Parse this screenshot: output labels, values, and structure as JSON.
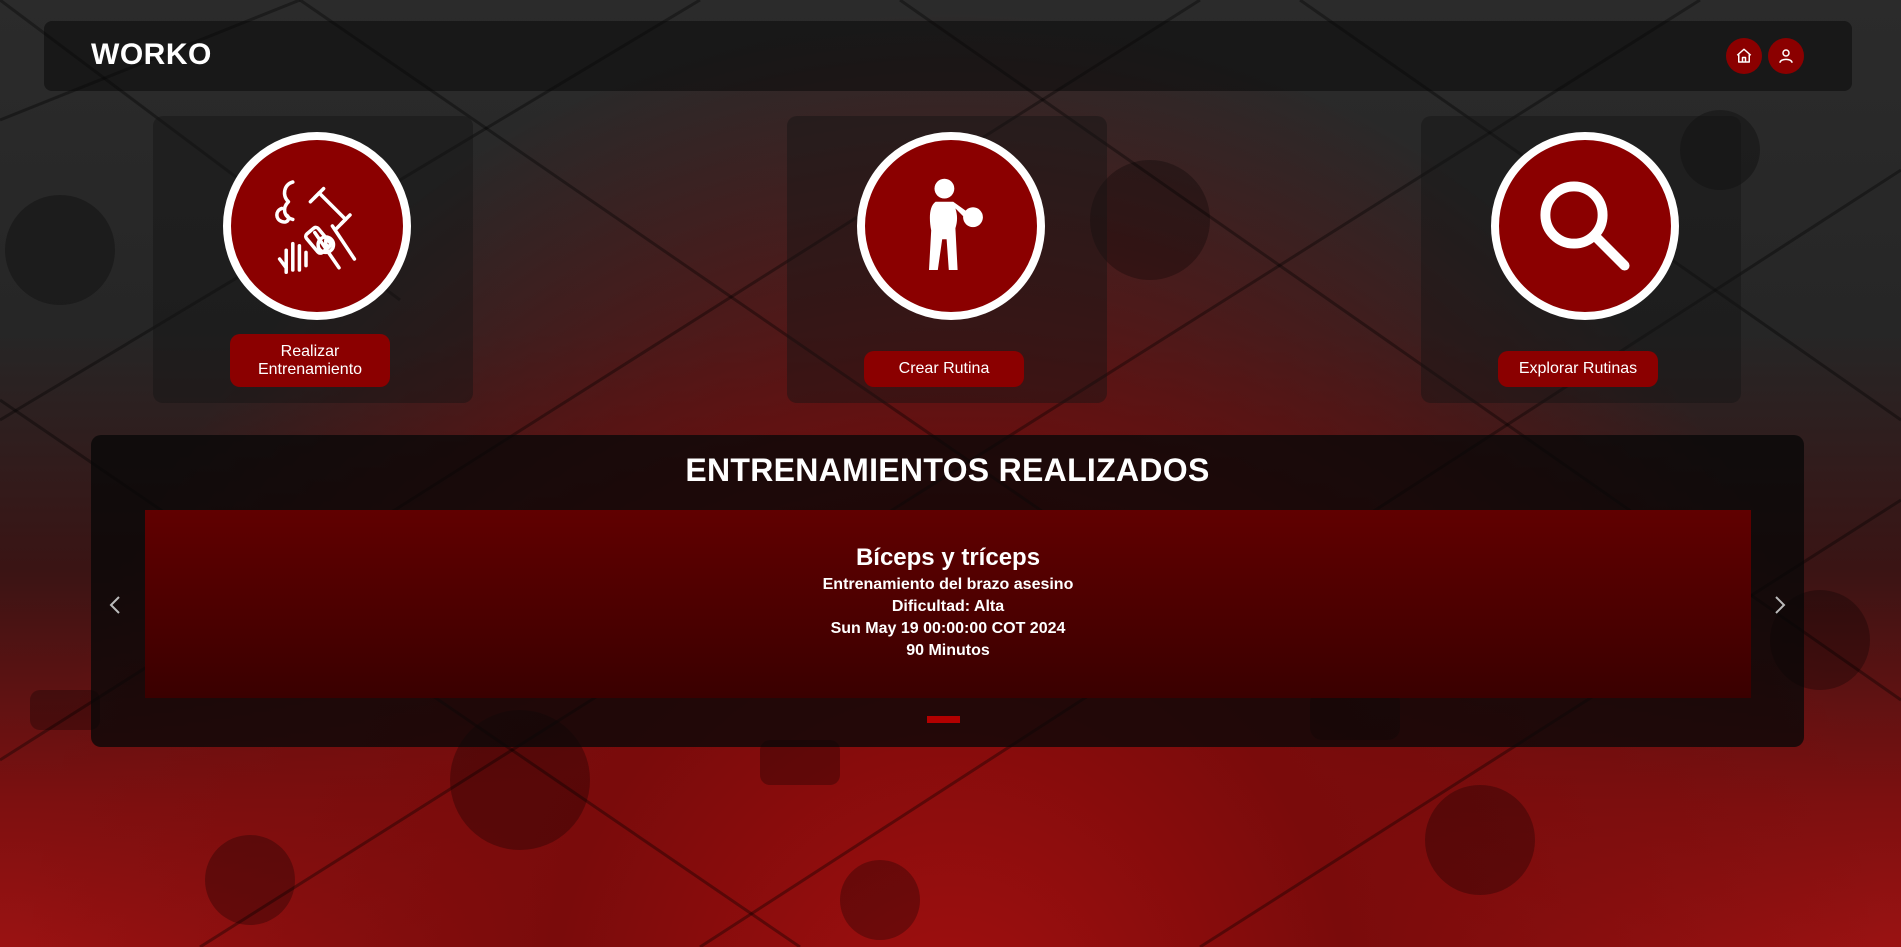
{
  "app": {
    "brand": "WORKO",
    "accent_color": "#8b0000"
  },
  "navbar": {
    "home_icon": "home-icon",
    "profile_icon": "user-icon"
  },
  "actions": [
    {
      "label": "Realizar Entrenamiento",
      "icon": "workout-equipment-icon"
    },
    {
      "label": "Crear Rutina",
      "icon": "person-ball-icon"
    },
    {
      "label": "Explorar Rutinas",
      "icon": "search-icon"
    }
  ],
  "history": {
    "title": "ENTRENAMIENTOS REALIZADOS",
    "slides": [
      {
        "name": "Bíceps y tríceps",
        "description": "Entrenamiento del brazo asesino",
        "difficulty": "Dificultad: Alta",
        "date": "Sun May 19 00:00:00 COT 2024",
        "duration": "90 Minutos"
      }
    ],
    "prev_icon": "chevron-left-icon",
    "next_icon": "chevron-right-icon",
    "active_index": 0
  }
}
